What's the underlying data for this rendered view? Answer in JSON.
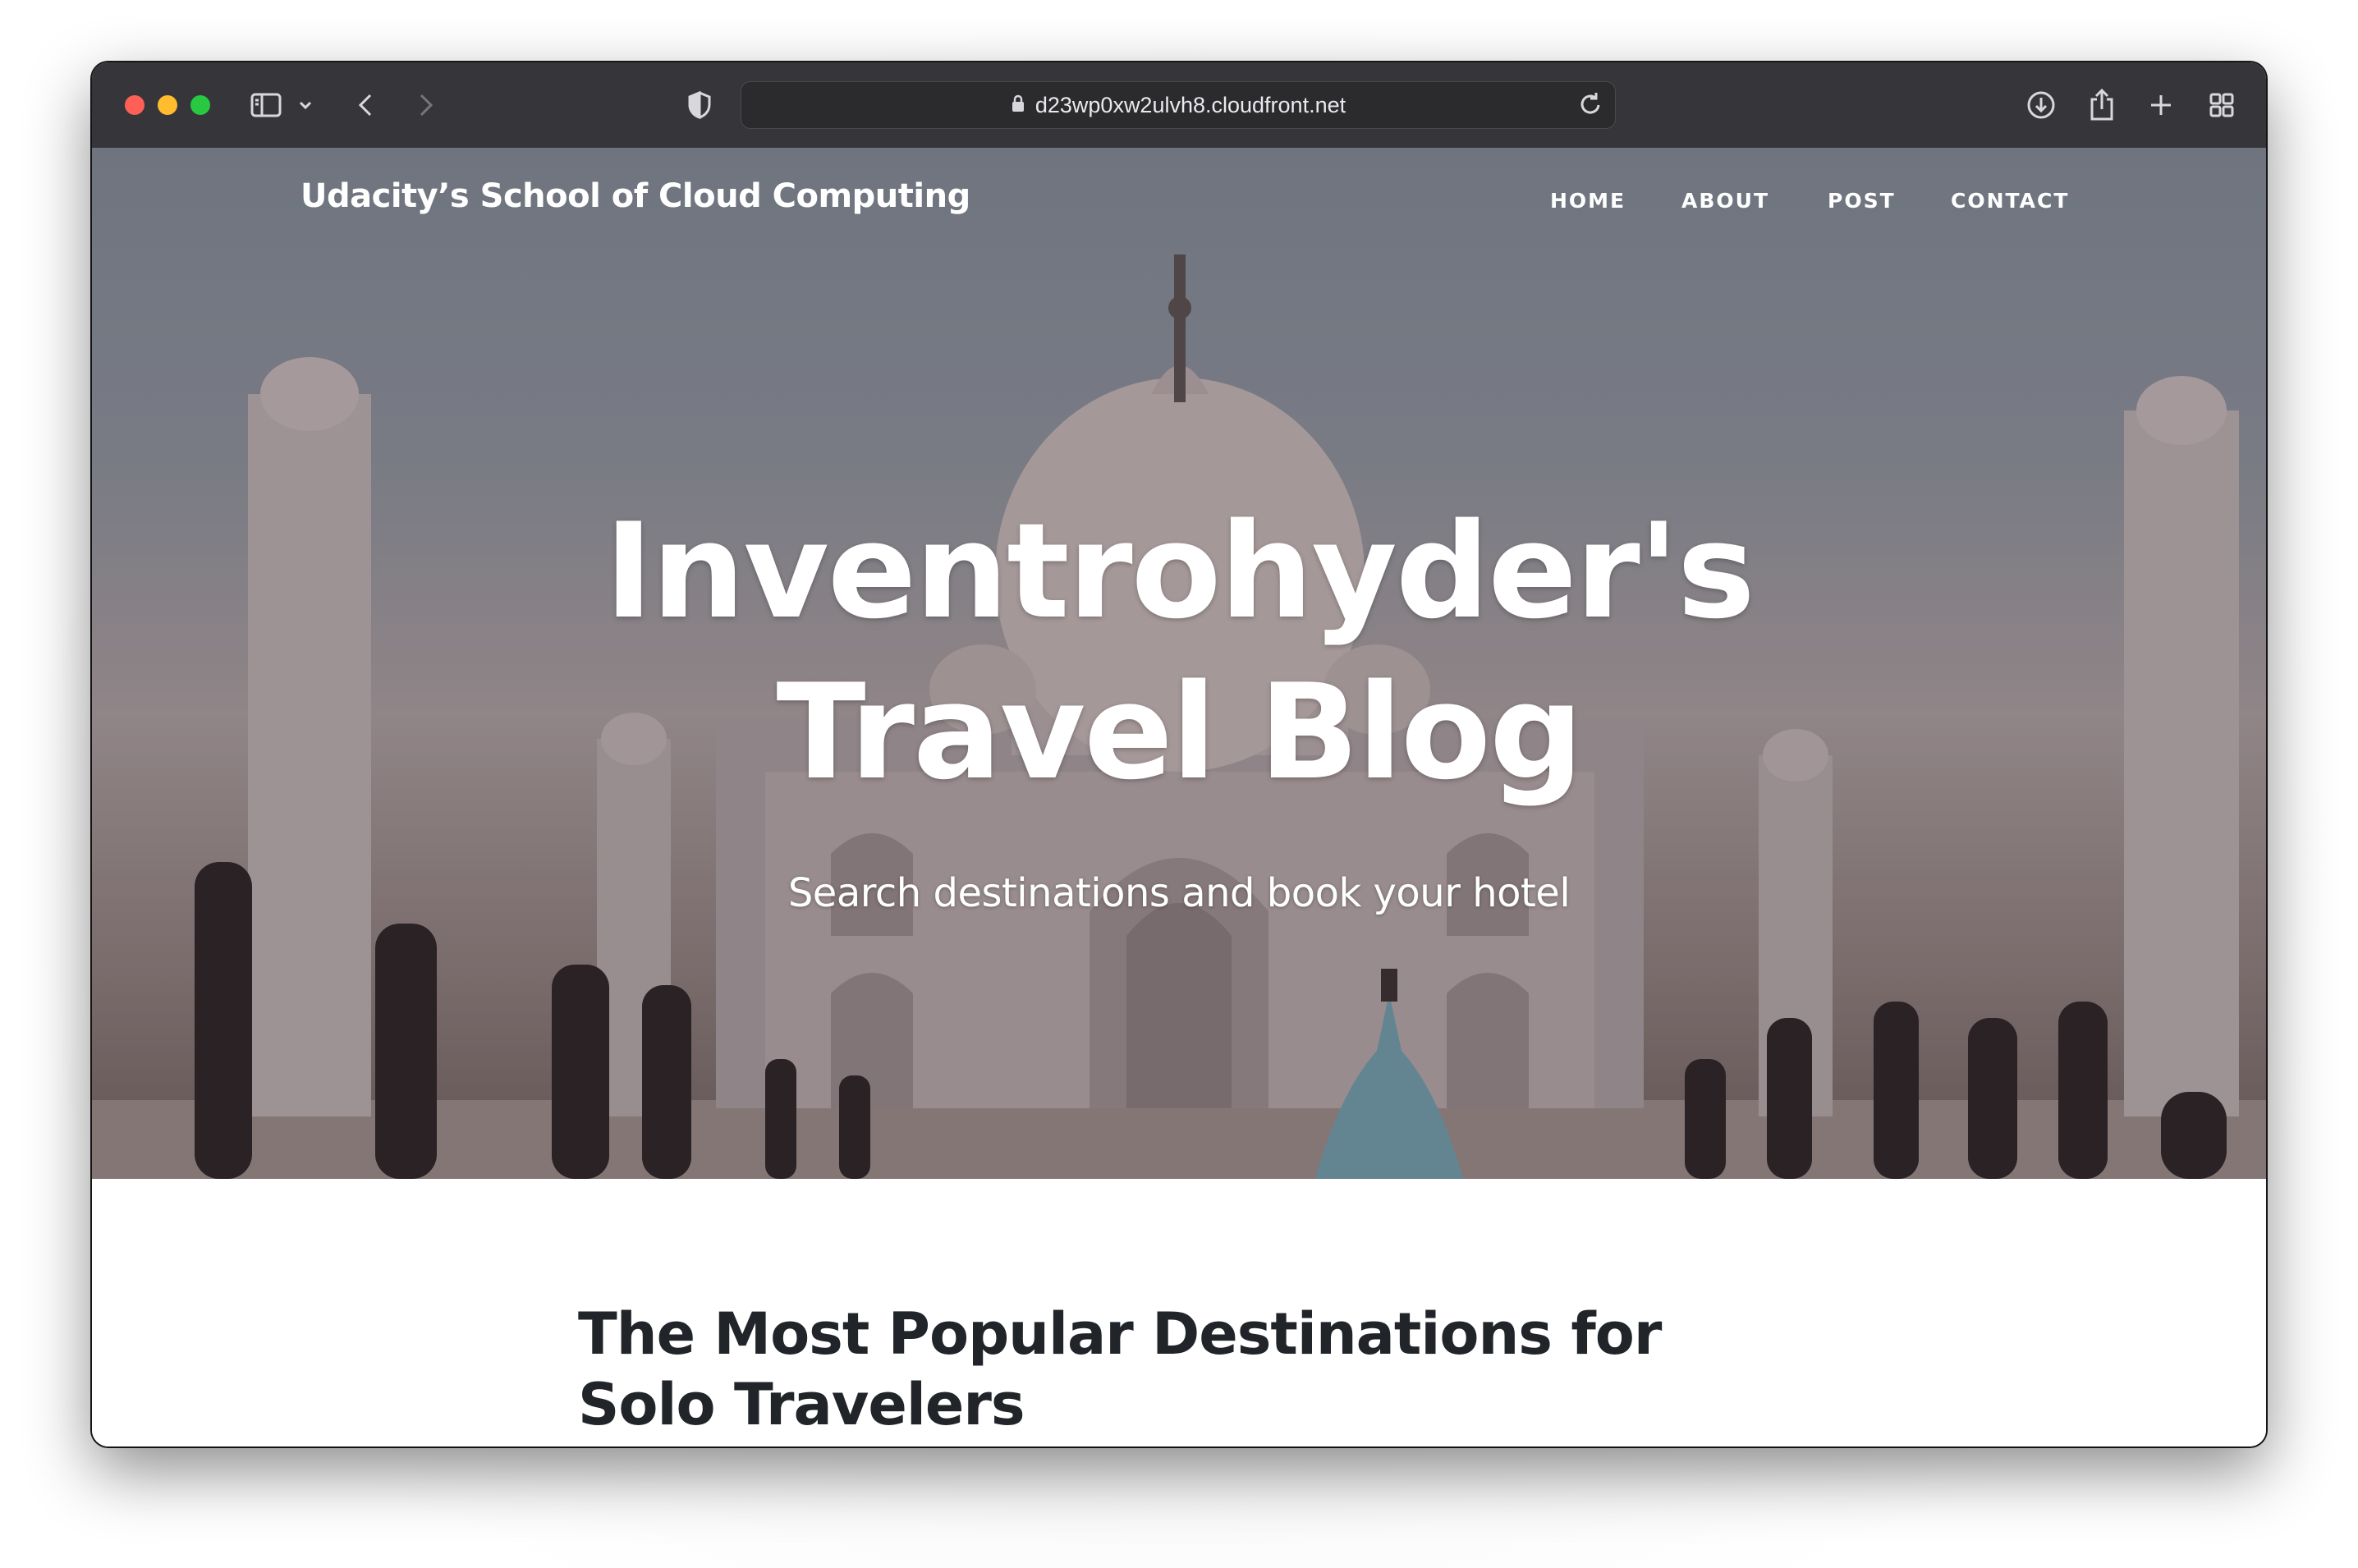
{
  "browser": {
    "url": "d23wp0xw2ulvh8.cloudfront.net"
  },
  "site": {
    "brand": "Udacity’s School of Cloud Computing",
    "nav": [
      "HOME",
      "ABOUT",
      "POST",
      "CONTACT"
    ]
  },
  "hero": {
    "title_line1": "Inventrohyder's",
    "title_line2": "Travel Blog",
    "subtitle": "Search destinations and book your hotel"
  },
  "post": {
    "title": "The Most Popular Destinations for Solo Travelers"
  }
}
